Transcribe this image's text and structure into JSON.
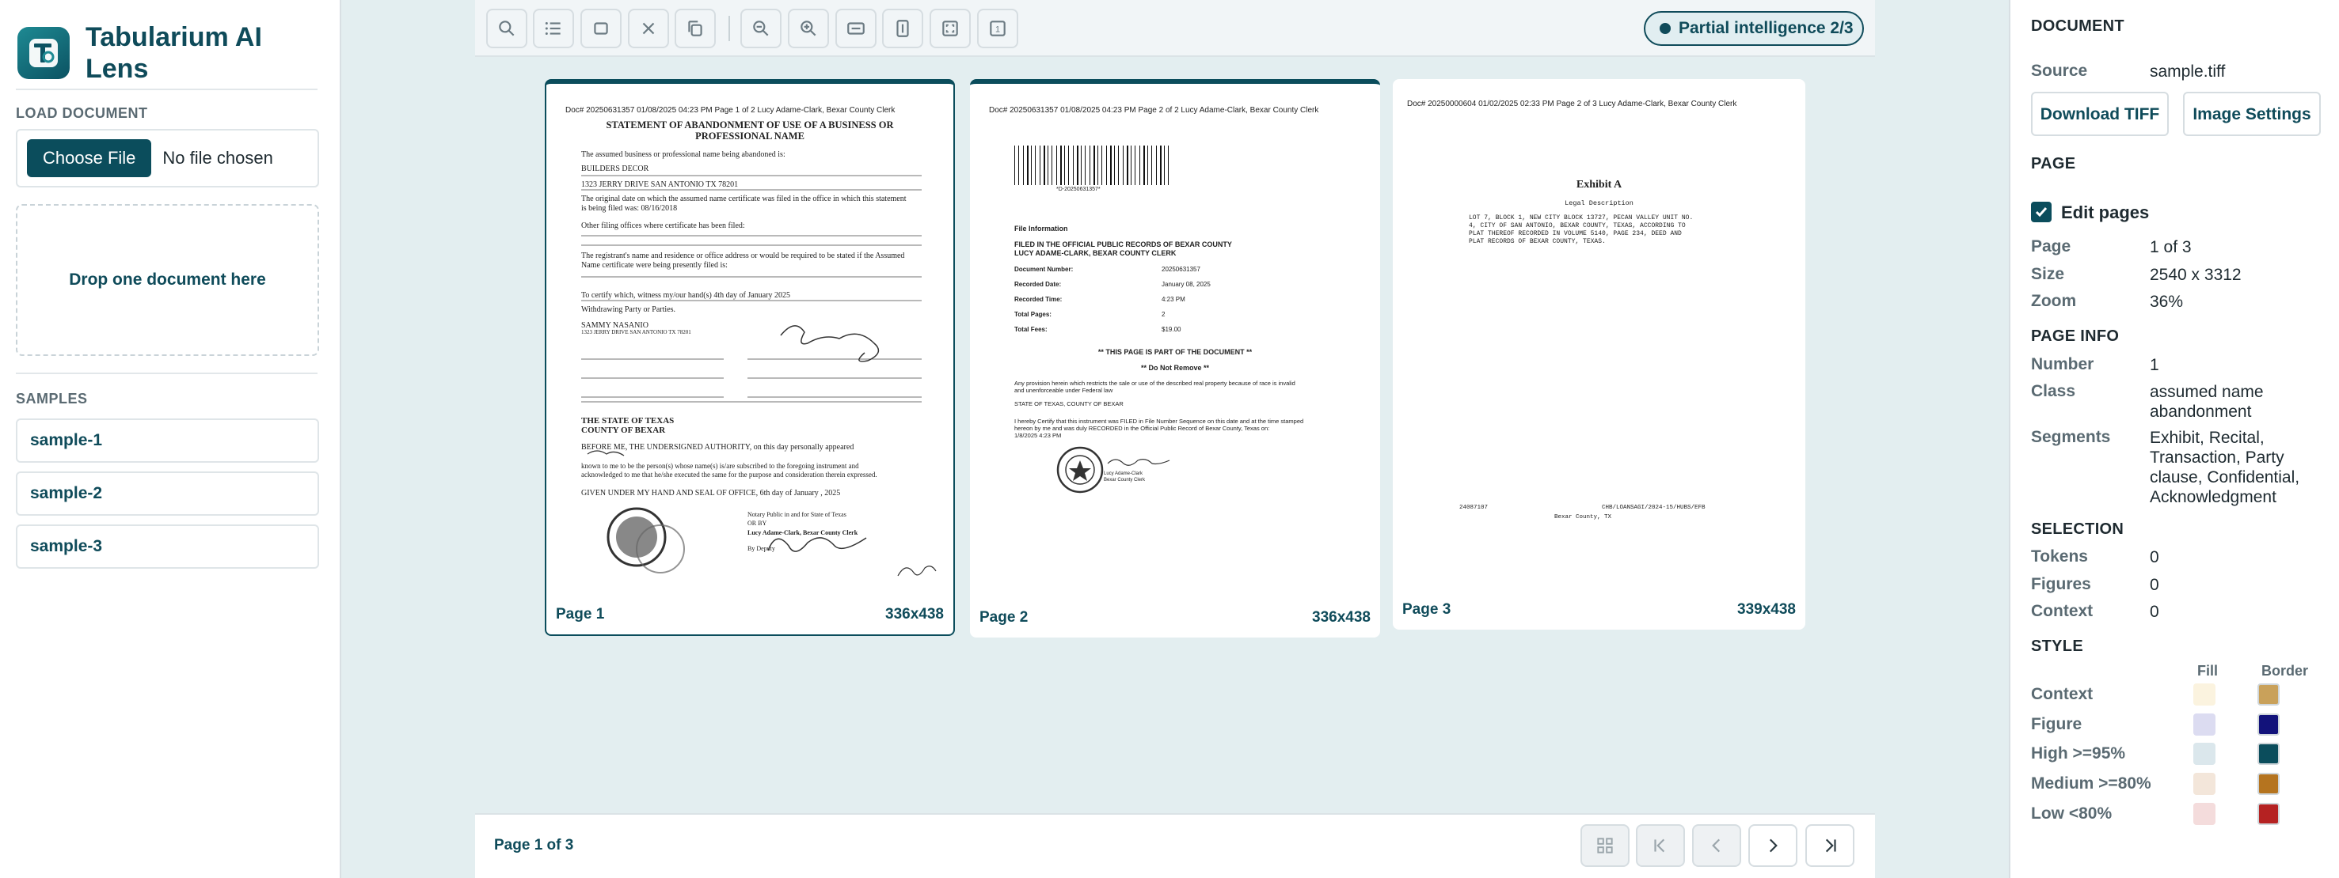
{
  "app": {
    "title": "Tabularium AI Lens"
  },
  "left": {
    "load_label": "LOAD DOCUMENT",
    "choose_file": "Choose File",
    "no_file": "No file chosen",
    "drop_text": "Drop one document here",
    "samples_label": "SAMPLES",
    "samples": [
      "sample-1",
      "sample-2",
      "sample-3"
    ]
  },
  "toolbar": {
    "icons": [
      "search-icon",
      "list-icon",
      "square-icon",
      "close-icon",
      "copy-icon",
      "zoom-out-icon",
      "zoom-in-icon",
      "fit-width-icon",
      "fit-height-icon",
      "fit-page-icon",
      "one-to-one-icon"
    ],
    "badge": "Partial intelligence 2/3"
  },
  "pages": [
    {
      "label": "Page 1",
      "size": "336x438",
      "header": "Doc# 20250631357 01/08/2025 04:23 PM Page 1 of 2 Lucy Adame-Clark, Bexar County Clerk",
      "title1": "STATEMENT OF ABANDONMENT OF USE OF A BUSINESS OR",
      "title2": "PROFESSIONAL NAME",
      "lines": [
        "The assumed business or professional name being abandoned is:",
        "BUILDERS DECOR",
        "1323 JERRY DRIVE SAN ANTONIO TX 78201",
        "The original date on which the assumed name certificate was filed in the office in which this statement",
        "is being filed was: 08/16/2018",
        "Other filing offices where certificate has been filed:",
        "The registrant's name and residence or office address or would be required to be stated if the Assumed",
        "Name certificate were being presently filed is:",
        "To certify which, witness my/our hand(s)   4th   day of   January   2025",
        "Withdrawing Party or Parties.",
        "SAMMY NASANIO",
        "1323 JERRY DRIVE SAN ANTONIO TX 78201",
        "THE STATE OF TEXAS",
        "COUNTY OF BEXAR",
        "BEFORE ME, THE UNDERSIGNED AUTHORITY, on this day personally appeared",
        "known to me to be the person(s) whose name(s) is/are subscribed to the foregoing instrument and",
        "acknowledged to me that he/she executed the same for the purpose and consideration therein expressed.",
        "GIVEN UNDER MY HAND AND SEAL OF OFFICE,   6th   day of   January   , 2025",
        "Notary Public in and for State of Texas",
        "OR BY",
        "Lucy Adame-Clark, Bexar County Clerk",
        "By                                Deputy"
      ]
    },
    {
      "label": "Page 2",
      "size": "336x438",
      "header": "Doc# 20250631357 01/08/2025 04:23 PM Page 2 of 2 Lucy Adame-Clark, Bexar County Clerk",
      "barcode_text": "*D-20250631357*",
      "file_info": "File Information",
      "filed1": "FILED IN THE OFFICIAL PUBLIC RECORDS OF BEXAR COUNTY",
      "filed2": "LUCY ADAME-CLARK, BEXAR COUNTY CLERK",
      "rows": [
        {
          "k": "Document Number:",
          "v": "20250631357"
        },
        {
          "k": "Recorded Date:",
          "v": "January 08, 2025"
        },
        {
          "k": "Recorded Time:",
          "v": "4:23 PM"
        },
        {
          "k": "Total Pages:",
          "v": "2"
        },
        {
          "k": "Total Fees:",
          "v": "$19.00"
        }
      ],
      "part_of": "** THIS PAGE IS PART OF THE DOCUMENT **",
      "do_not_remove": "** Do Not Remove **",
      "provision1": "Any provision herein which restricts the sale or use of the described real property because of race is invalid",
      "provision2": "and unenforceable under Federal law",
      "state_line": "STATE OF TEXAS, COUNTY OF BEXAR",
      "certify1": "I hereby Certify that this instrument was FILED in File Number Sequence on this date and at the time stamped",
      "certify2": "hereon by me and was duly RECORDED in the Official Public Record of Bexar County, Texas on:",
      "certify3": "1/8/2025 4:23 PM",
      "sig_caption1": "Lucy Adame-Clark",
      "sig_caption2": "Bexar County Clerk"
    },
    {
      "label": "Page 3",
      "size": "339x438",
      "header": "Doc# 20250000604 01/02/2025 02:33 PM Page 2 of 3 Lucy Adame-Clark, Bexar County Clerk",
      "exhibit": "Exhibit A",
      "legal": "Legal Description",
      "desc": [
        "LOT 7, BLOCK 1, NEW CITY BLOCK 13727, PECAN VALLEY UNIT NO.",
        "4, CITY OF SAN ANTONIO, BEXAR COUNTY, TEXAS, ACCORDING TO",
        "PLAT THEREOF RECORDED IN VOLUME 5140, PAGE 234, DEED AND",
        "PLAT RECORDS OF BEXAR COUNTY, TEXAS."
      ],
      "foot_left": "24087107",
      "foot_mid": "CHB/LOANSAGI/2024-15/HUBS/EFB",
      "foot_city": "Bexar County, TX"
    }
  ],
  "footer": {
    "page_indicator": "Page 1 of 3"
  },
  "right": {
    "document_head": "DOCUMENT",
    "source_label": "Source",
    "source_value": "sample.tiff",
    "download_btn": "Download TIFF",
    "image_settings_btn": "Image Settings",
    "page_head": "PAGE",
    "edit_pages": "Edit pages",
    "page_label": "Page",
    "page_value": "1 of 3",
    "size_label": "Size",
    "size_value": "2540 x 3312",
    "zoom_label": "Zoom",
    "zoom_value": "36%",
    "page_info_head": "PAGE INFO",
    "number_label": "Number",
    "number_value": "1",
    "class_label": "Class",
    "class_value": "assumed name abandonment",
    "segments_label": "Segments",
    "segments_value": "Exhibit, Recital, Transaction, Party clause, Confidential, Acknowledgment",
    "selection_head": "SELECTION",
    "tokens_label": "Tokens",
    "tokens_value": "0",
    "figures_label": "Figures",
    "figures_value": "0",
    "context_label": "Context",
    "context_value": "0",
    "style_head": "STYLE",
    "fill_col": "Fill",
    "border_col": "Border",
    "styles": [
      {
        "label": "Context",
        "fill": "#fbf3df",
        "border": "#c9a15a"
      },
      {
        "label": "Figure",
        "fill": "#dcdcf1",
        "border": "#12127a"
      },
      {
        "label": "High >=95%",
        "fill": "#dbe7ec",
        "border": "#0b4d5c"
      },
      {
        "label": "Medium >=80%",
        "fill": "#f3e6da",
        "border": "#b5741f"
      },
      {
        "label": "Low <80%",
        "fill": "#f4dcdc",
        "border": "#b52222"
      }
    ]
  }
}
